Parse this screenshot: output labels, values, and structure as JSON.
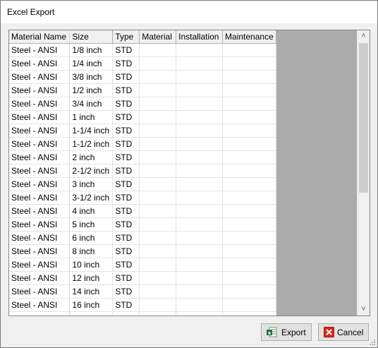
{
  "window": {
    "title": "Excel Export"
  },
  "grid": {
    "columns": [
      "Material Name",
      "Size",
      "Type",
      "Material",
      "Installation",
      "Maintenance"
    ],
    "rows": [
      [
        "Steel - ANSI",
        "1/8 inch",
        "STD",
        "",
        "",
        ""
      ],
      [
        "Steel - ANSI",
        "1/4 inch",
        "STD",
        "",
        "",
        ""
      ],
      [
        "Steel - ANSI",
        "3/8 inch",
        "STD",
        "",
        "",
        ""
      ],
      [
        "Steel - ANSI",
        "1/2 inch",
        "STD",
        "",
        "",
        ""
      ],
      [
        "Steel - ANSI",
        "3/4 inch",
        "STD",
        "",
        "",
        ""
      ],
      [
        "Steel - ANSI",
        "1 inch",
        "STD",
        "",
        "",
        ""
      ],
      [
        "Steel - ANSI",
        "1-1/4 inch",
        "STD",
        "",
        "",
        ""
      ],
      [
        "Steel - ANSI",
        "1-1/2 inch",
        "STD",
        "",
        "",
        ""
      ],
      [
        "Steel - ANSI",
        "2 inch",
        "STD",
        "",
        "",
        ""
      ],
      [
        "Steel - ANSI",
        "2-1/2 inch",
        "STD",
        "",
        "",
        ""
      ],
      [
        "Steel - ANSI",
        "3 inch",
        "STD",
        "",
        "",
        ""
      ],
      [
        "Steel - ANSI",
        "3-1/2 inch",
        "STD",
        "",
        "",
        ""
      ],
      [
        "Steel - ANSI",
        "4 inch",
        "STD",
        "",
        "",
        ""
      ],
      [
        "Steel - ANSI",
        "5 inch",
        "STD",
        "",
        "",
        ""
      ],
      [
        "Steel - ANSI",
        "6 inch",
        "STD",
        "",
        "",
        ""
      ],
      [
        "Steel - ANSI",
        "8 inch",
        "STD",
        "",
        "",
        ""
      ],
      [
        "Steel - ANSI",
        "10 inch",
        "STD",
        "",
        "",
        ""
      ],
      [
        "Steel - ANSI",
        "12 inch",
        "STD",
        "",
        "",
        ""
      ],
      [
        "Steel - ANSI",
        "14 inch",
        "STD",
        "",
        "",
        ""
      ],
      [
        "Steel - ANSI",
        "16 inch",
        "STD",
        "",
        "",
        ""
      ],
      [
        "",
        "",
        "",
        "",
        "",
        ""
      ]
    ]
  },
  "scrollbar": {
    "up_icon": "chevron-up-icon",
    "down_icon": "chevron-down-icon"
  },
  "buttons": {
    "export": {
      "label": "Export",
      "icon": "excel-icon"
    },
    "cancel": {
      "label": "Cancel",
      "icon": "red-x-icon"
    }
  },
  "colors": {
    "excel_green": "#1e7145",
    "cancel_red": "#d9281f",
    "empty_area": "#ababab"
  }
}
